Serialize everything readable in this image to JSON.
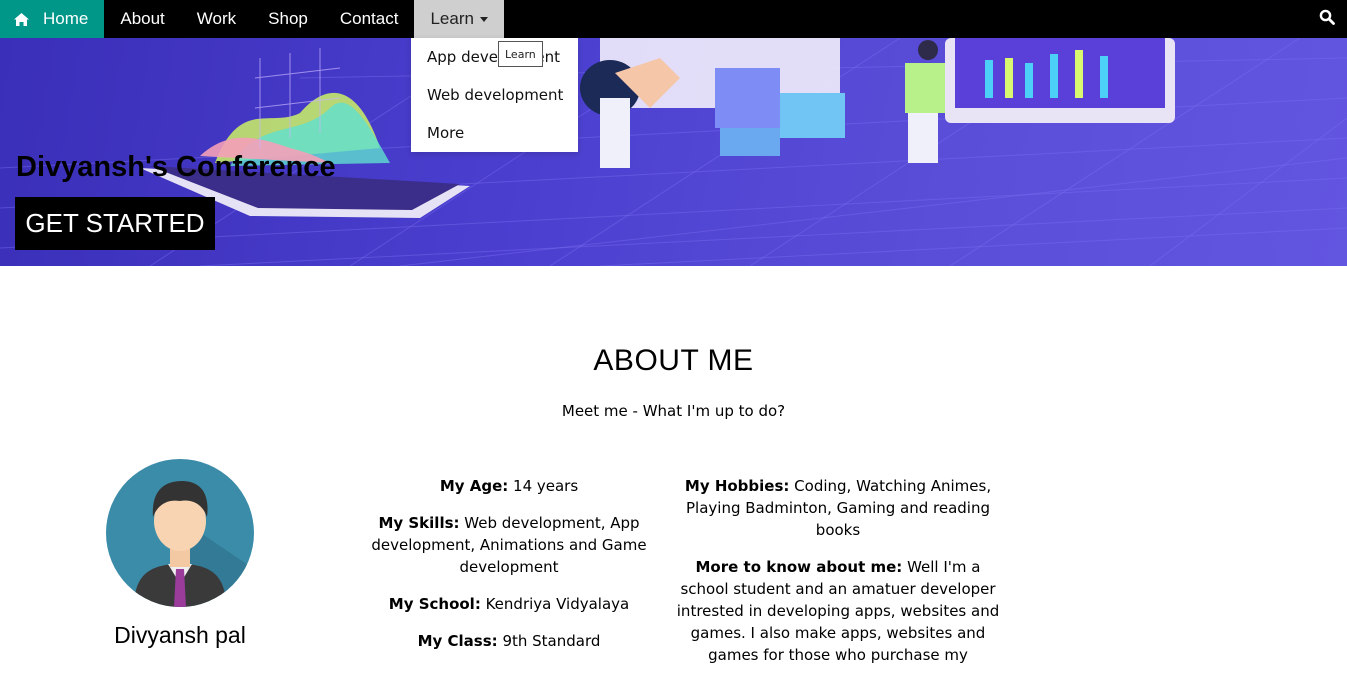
{
  "nav": {
    "items": [
      "Home",
      "About",
      "Work",
      "Shop",
      "Contact",
      "Learn"
    ],
    "active": "Home",
    "open_menu": "Learn"
  },
  "dropdown": {
    "items": [
      "App development",
      "Web development",
      "More"
    ]
  },
  "tooltip": "Learn",
  "hero": {
    "title": "Divyansh's Conference",
    "button": "GET STARTED"
  },
  "about": {
    "heading": "ABOUT ME",
    "subtitle": "Meet me - What I'm up to do?",
    "name": "Divyansh pal",
    "fields": [
      {
        "label": "My Age:",
        "value": " 14 years"
      },
      {
        "label": "My Skills:",
        "value": " Web development, App development, Animations and Game development"
      },
      {
        "label": "My School:",
        "value": " Kendriya Vidyalaya"
      },
      {
        "label": "My Class:",
        "value": " 9th Standard"
      },
      {
        "label": "My Hobbies:",
        "value": " Coding, Watching Animes, Playing Badminton, Gaming and reading books"
      },
      {
        "label": "More to know about me:",
        "value": " Well I'm a school student and an amatuer developer intrested in developing apps, websites and games. I also make apps, websites and games for those who purchase my"
      }
    ]
  },
  "colors": {
    "nav_bg": "#000000",
    "home_active": "#009688",
    "learn_active": "#cfcfcf",
    "hero_purple": "#4b3fd0"
  },
  "icons": [
    "home-icon",
    "search-icon",
    "caret-down-icon"
  ]
}
